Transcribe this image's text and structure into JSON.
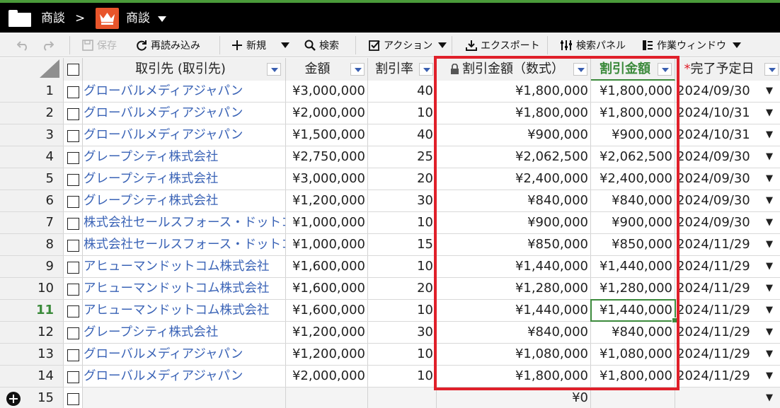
{
  "titlebar": {
    "folder_label": "商談",
    "separator": ">",
    "app_label": "商談",
    "accent_color": "#e8552b"
  },
  "toolbar": {
    "undo_icon": "undo-icon",
    "redo_icon": "redo-icon",
    "save_label": "保存",
    "reload_label": "再読み込み",
    "new_label": "新規",
    "search_label": "検索",
    "action_label": "アクション",
    "export_label": "エクスポート",
    "search_panel_label": "検索パネル",
    "work_window_label": "作業ウィンドウ"
  },
  "grid": {
    "columns": {
      "account": "取引先 (取引先)",
      "amount": "金額",
      "rate": "割引率",
      "discount_formula": "割引金額（数式）",
      "discount": "割引金額",
      "close_date": "完了予定日"
    },
    "required_mark": "*",
    "rows": [
      {
        "n": "1",
        "account": "グローバルメディアジャパン",
        "amount": "¥3,000,000",
        "rate": "40",
        "disc1": "¥1,800,000",
        "disc2": "¥1,800,000",
        "date": "2024/09/30"
      },
      {
        "n": "2",
        "account": "グローバルメディアジャパン",
        "amount": "¥2,000,000",
        "rate": "10",
        "disc1": "¥1,800,000",
        "disc2": "¥1,800,000",
        "date": "2024/10/31"
      },
      {
        "n": "3",
        "account": "グローバルメディアジャパン",
        "amount": "¥1,500,000",
        "rate": "40",
        "disc1": "¥900,000",
        "disc2": "¥900,000",
        "date": "2024/10/31"
      },
      {
        "n": "4",
        "account": "グレープシティ株式会社",
        "amount": "¥2,750,000",
        "rate": "25",
        "disc1": "¥2,062,500",
        "disc2": "¥2,062,500",
        "date": "2024/09/30"
      },
      {
        "n": "5",
        "account": "グレープシティ株式会社",
        "amount": "¥3,000,000",
        "rate": "20",
        "disc1": "¥2,400,000",
        "disc2": "¥2,400,000",
        "date": "2024/09/30"
      },
      {
        "n": "6",
        "account": "グレープシティ株式会社",
        "amount": "¥1,200,000",
        "rate": "30",
        "disc1": "¥840,000",
        "disc2": "¥840,000",
        "date": "2024/09/30"
      },
      {
        "n": "7",
        "account": "株式会社セールスフォース・ドットコム",
        "amount": "¥1,000,000",
        "rate": "10",
        "disc1": "¥900,000",
        "disc2": "¥900,000",
        "date": "2024/09/30"
      },
      {
        "n": "8",
        "account": "株式会社セールスフォース・ドットコム",
        "amount": "¥1,000,000",
        "rate": "15",
        "disc1": "¥850,000",
        "disc2": "¥850,000",
        "date": "2024/11/29"
      },
      {
        "n": "9",
        "account": "アヒューマンドットコム株式会社",
        "amount": "¥1,600,000",
        "rate": "10",
        "disc1": "¥1,440,000",
        "disc2": "¥1,440,000",
        "date": "2024/11/29"
      },
      {
        "n": "10",
        "account": "アヒューマンドットコム株式会社",
        "amount": "¥1,600,000",
        "rate": "20",
        "disc1": "¥1,280,000",
        "disc2": "¥1,280,000",
        "date": "2024/11/29"
      },
      {
        "n": "11",
        "account": "アヒューマンドットコム株式会社",
        "amount": "¥1,600,000",
        "rate": "10",
        "disc1": "¥1,440,000",
        "disc2": "¥1,440,000",
        "date": "2024/11/29"
      },
      {
        "n": "12",
        "account": "グレープシティ株式会社",
        "amount": "¥1,200,000",
        "rate": "30",
        "disc1": "¥840,000",
        "disc2": "¥840,000",
        "date": "2024/11/29"
      },
      {
        "n": "13",
        "account": "グローバルメディアジャパン",
        "amount": "¥1,200,000",
        "rate": "10",
        "disc1": "¥1,080,000",
        "disc2": "¥1,080,000",
        "date": "2024/11/29"
      },
      {
        "n": "14",
        "account": "グローバルメディアジャパン",
        "amount": "¥2,000,000",
        "rate": "10",
        "disc1": "¥1,800,000",
        "disc2": "¥1,800,000",
        "date": "2024/11/29"
      }
    ],
    "new_row": {
      "n": "15",
      "disc1": "¥0"
    },
    "active_row_index": 10,
    "highlight_color": "#e0202a",
    "selection_color": "#3c8a3c"
  }
}
